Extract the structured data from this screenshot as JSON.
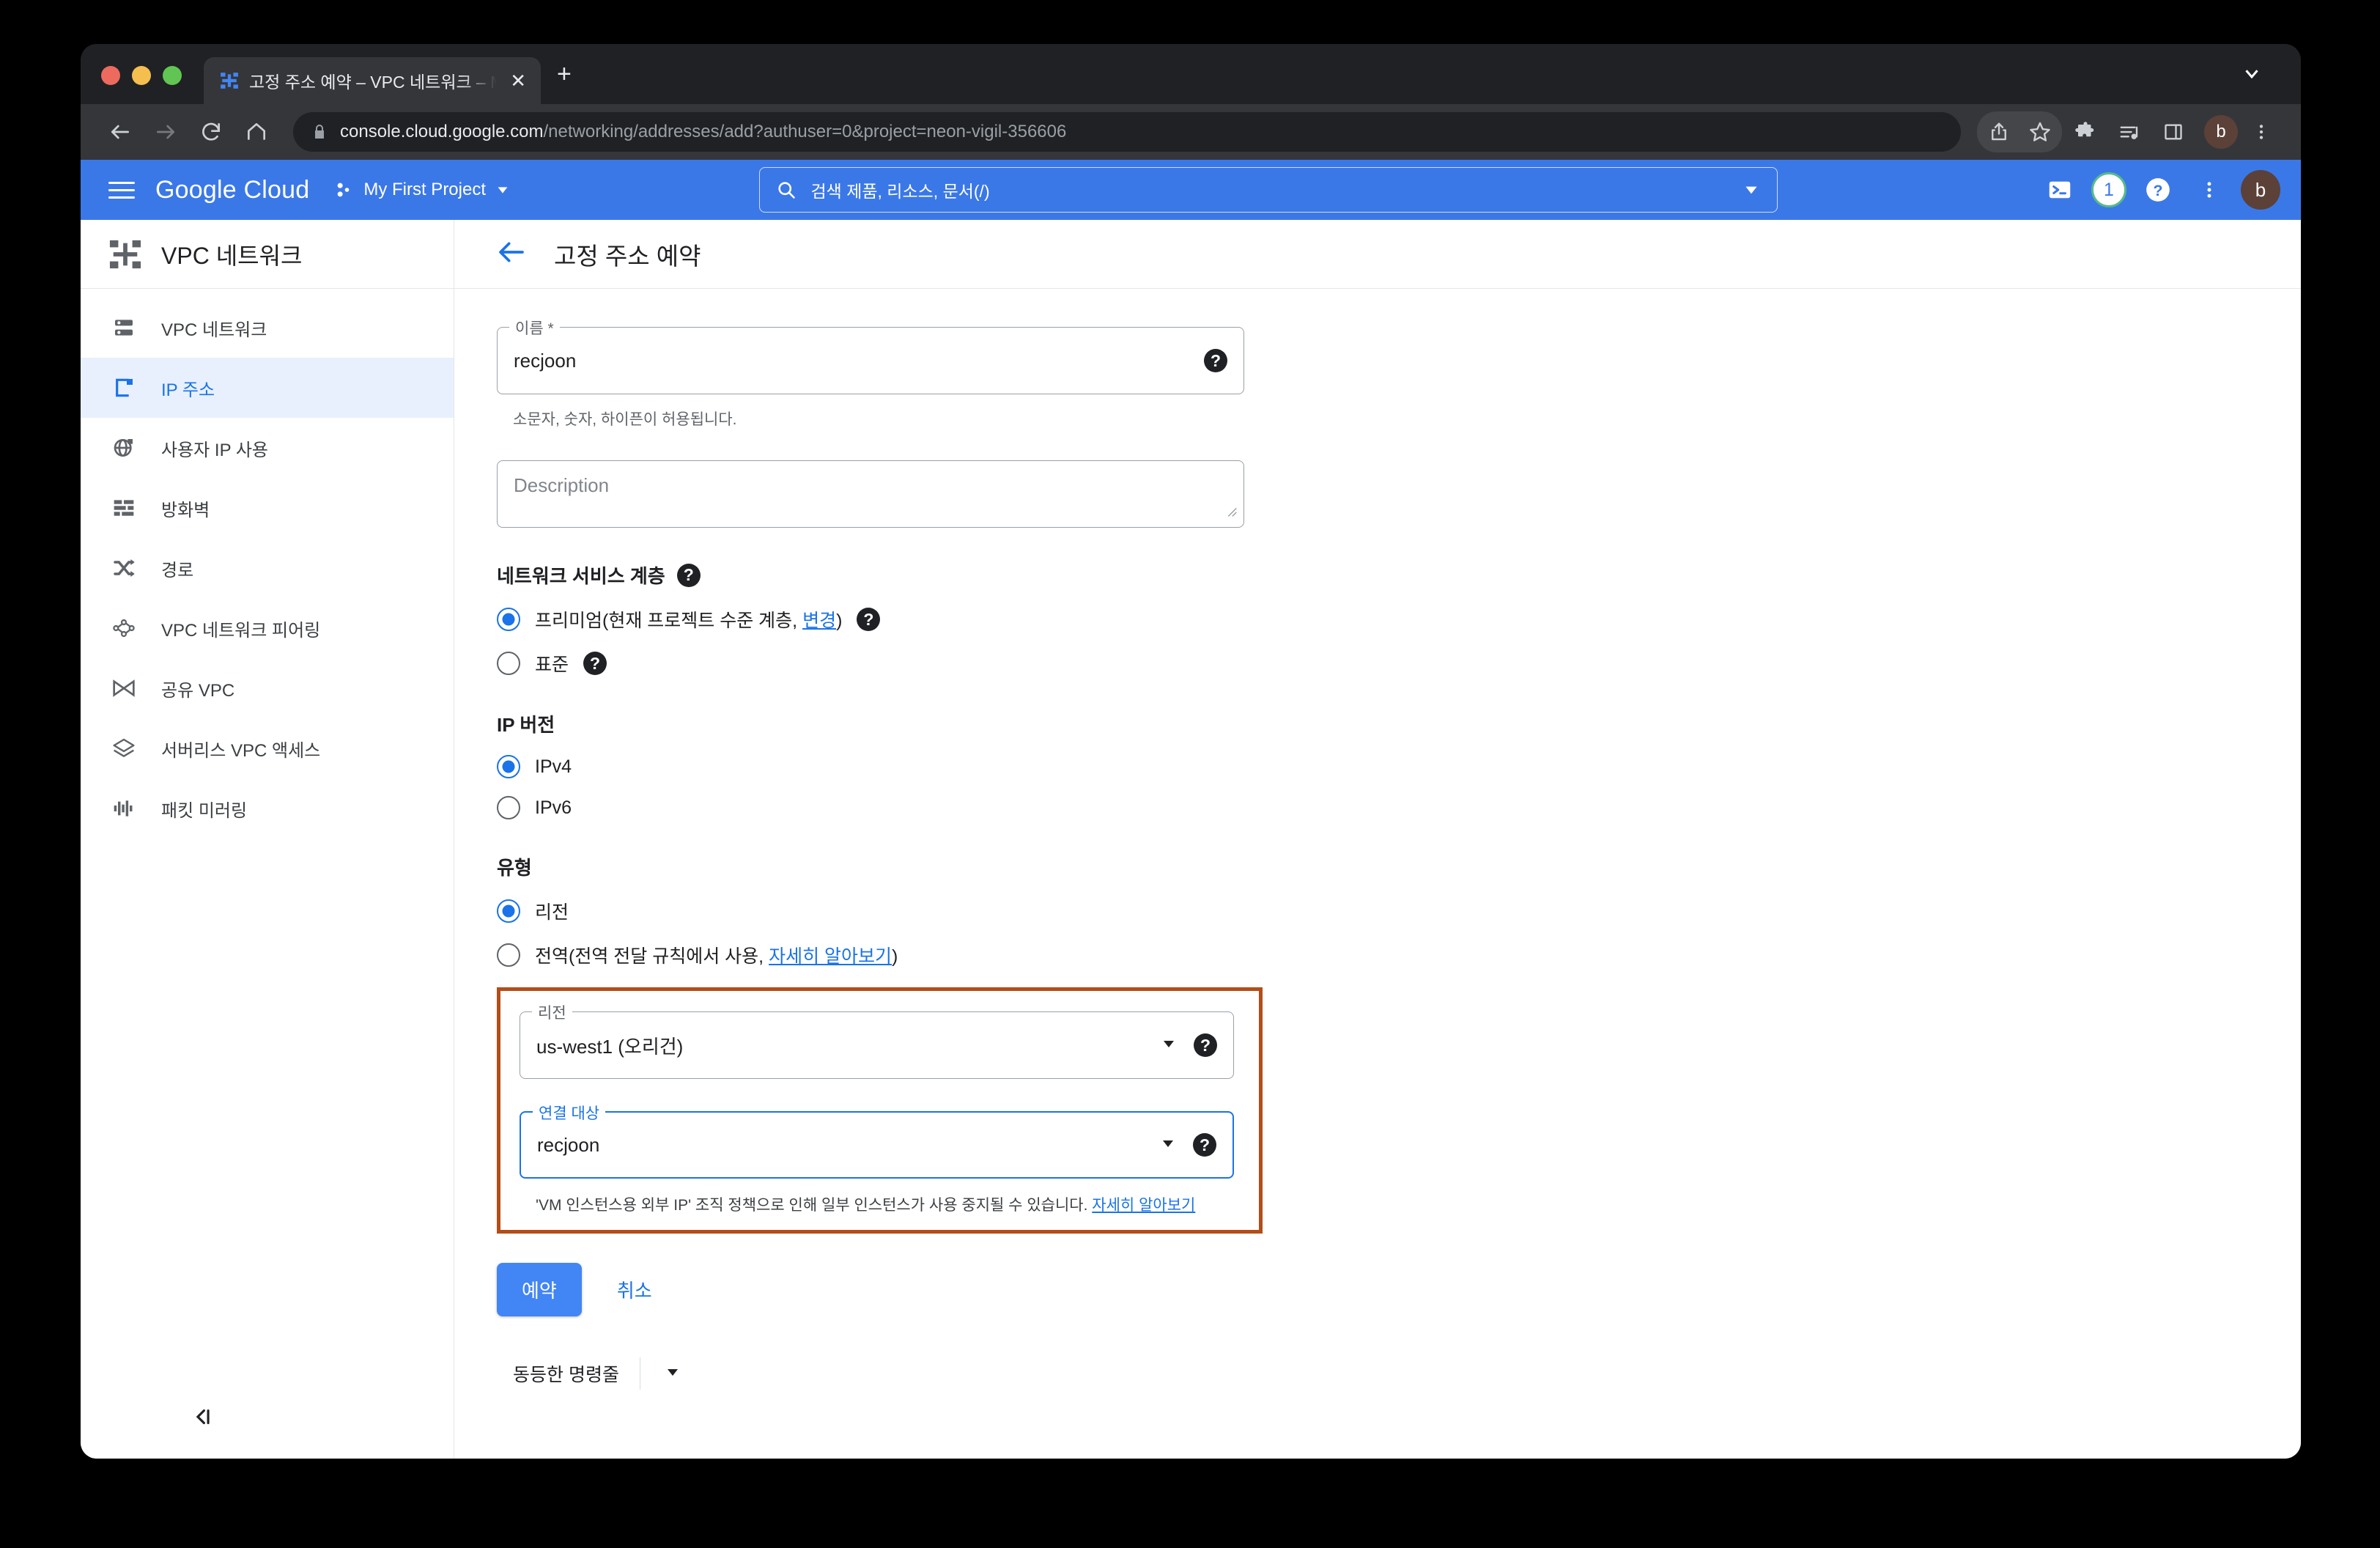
{
  "browser": {
    "tab": {
      "title": "고정 주소 예약 – VPC 네트워크 – M",
      "favicon_name": "gcp-vpc-favicon",
      "close_label": "✕"
    },
    "newtab_label": "+",
    "url_host": "console.cloud.google.com",
    "url_path": "/networking/addresses/add?authuser=0&project=neon-vigil-356606",
    "profile_initial": "b",
    "icons": [
      "back-icon",
      "forward-icon",
      "reload-icon",
      "home-icon",
      "lock-icon",
      "share-icon",
      "bookmark-star-icon",
      "extensions-icon",
      "media-playlist-icon",
      "side-panel-icon",
      "chrome-menu-icon",
      "tab-list-chevron-icon"
    ]
  },
  "gcp_header": {
    "brand": "Google Cloud",
    "project_name": "My First Project",
    "search_placeholder": "검색  제품, 리소스, 문서(/)",
    "notification_count": "1",
    "avatar_initial": "b",
    "accent_blue": "#3b78e7",
    "badge_ring": "#57bb8a"
  },
  "sidebar": {
    "title": "VPC 네트워크",
    "items": [
      {
        "label": "VPC 네트워크",
        "icon": "vpc-network-icon",
        "active": false
      },
      {
        "label": "IP 주소",
        "icon": "ip-address-icon",
        "active": true
      },
      {
        "label": "사용자 IP 사용",
        "icon": "user-ip-usage-icon",
        "active": false
      },
      {
        "label": "방화벽",
        "icon": "firewall-icon",
        "active": false
      },
      {
        "label": "경로",
        "icon": "routes-icon",
        "active": false
      },
      {
        "label": "VPC 네트워크 피어링",
        "icon": "vpc-peering-icon",
        "active": false
      },
      {
        "label": "공유 VPC",
        "icon": "shared-vpc-icon",
        "active": false
      },
      {
        "label": "서버리스 VPC 액세스",
        "icon": "serverless-vpc-access-icon",
        "active": false
      },
      {
        "label": "패킷 미러링",
        "icon": "packet-mirroring-icon",
        "active": false
      }
    ],
    "collapse_icon": "collapse-sidebar-icon"
  },
  "page": {
    "title": "고정 주소 예약",
    "back_icon": "back-arrow-icon"
  },
  "form": {
    "name": {
      "legend": "이름 *",
      "value": "recjoon",
      "helper": "소문자, 숫자, 하이픈이 허용됩니다."
    },
    "description": {
      "placeholder": "Description",
      "value": ""
    },
    "network_tier": {
      "title": "네트워크 서비스 계층",
      "options": [
        {
          "label_before": "프리미엄(현재 프로젝트 수준 계층, ",
          "link": "변경",
          "label_after": ")",
          "checked": true
        },
        {
          "label_before": "표준",
          "link": "",
          "label_after": "",
          "checked": false
        }
      ]
    },
    "ip_version": {
      "title": "IP 버전",
      "options": [
        {
          "label": "IPv4",
          "checked": true
        },
        {
          "label": "IPv6",
          "checked": false
        }
      ]
    },
    "type": {
      "title": "유형",
      "options": [
        {
          "label_before": "리전",
          "link": "",
          "label_after": "",
          "checked": true
        },
        {
          "label_before": "전역(전역 전달 규칙에서 사용, ",
          "link": "자세히 알아보기",
          "label_after": ")",
          "checked": false
        }
      ]
    },
    "region": {
      "legend": "리전",
      "value": "us-west1 (오리건)"
    },
    "attach_to": {
      "legend": "연결 대상",
      "value": "recjoon",
      "focused": true
    },
    "warning": {
      "text": "'VM 인스턴스용 외부 IP' 조직 정책으로 인해 일부 인스턴스가 사용 중지될 수 있습니다. ",
      "link": "자세히 알아보기"
    },
    "highlight_color": "#b44d18"
  },
  "actions": {
    "submit_label": "예약",
    "cancel_label": "취소",
    "command_line_label": "동등한 명령줄"
  }
}
